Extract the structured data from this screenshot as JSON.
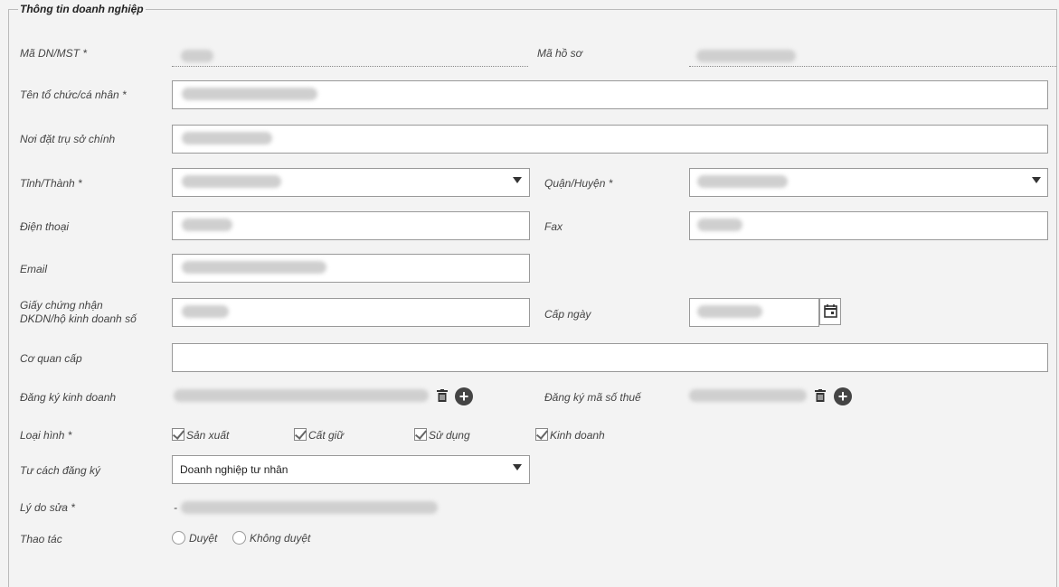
{
  "section": {
    "legend": "Thông tin doanh nghiệp"
  },
  "labels": {
    "ma_dn": "Mã DN/MST *",
    "ma_ho_so": "Mã hồ sơ",
    "ten_to_chuc": "Tên tổ chức/cá nhân *",
    "noi_dat_tru_so": "Nơi đặt trụ sở chính",
    "tinh_thanh": "Tỉnh/Thành *",
    "quan_huyen": "Quận/Huyện *",
    "dien_thoai": "Điện thoại",
    "fax": "Fax",
    "email": "Email",
    "giay_chung_nhan_1": "Giấy chứng nhận",
    "giay_chung_nhan_2": "DKDN/hộ kinh doanh số",
    "cap_ngay": "Cấp ngày",
    "co_quan_cap": "Cơ quan cấp",
    "dang_ky_kinh_doanh": "Đăng ký kinh doanh",
    "dang_ky_ma_so_thue": "Đăng ký mã số thuế",
    "loai_hinh": "Loại hình *",
    "tu_cach_dang_ky": "Tư cách đăng ký",
    "ly_do_sua": "Lý do sửa *",
    "thao_tac": "Thao tác"
  },
  "loai_hinh_options": [
    "Sản xuất",
    "Cất giữ",
    "Sử dụng",
    "Kinh doanh"
  ],
  "tu_cach_dang_ky": {
    "selected": "Doanh nghiệp tư nhân"
  },
  "ly_do_sua_prefix": "-",
  "thao_tac_options": [
    "Duyệt",
    "Không duyệt"
  ],
  "icons": [
    "trash-icon",
    "add-circle-icon",
    "calendar-icon",
    "dropdown-caret-icon",
    "checkbox-icon",
    "radio-icon"
  ]
}
